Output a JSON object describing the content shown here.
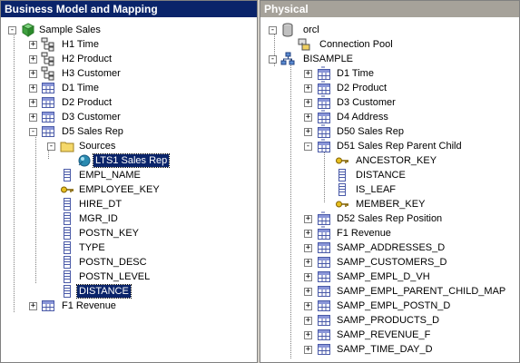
{
  "left_panel": {
    "title": "Business Model and Mapping",
    "nodes": [
      {
        "label": "Sample Sales",
        "icon": "business-model-icon",
        "expander": "-"
      },
      {
        "label": "H1 Time",
        "icon": "hierarchy-icon",
        "expander": "+"
      },
      {
        "label": "H2 Product",
        "icon": "hierarchy-icon",
        "expander": "+"
      },
      {
        "label": "H3 Customer",
        "icon": "hierarchy-icon",
        "expander": "+"
      },
      {
        "label": "D1 Time",
        "icon": "logical-table-icon",
        "expander": "+"
      },
      {
        "label": "D2 Product",
        "icon": "logical-table-icon",
        "expander": "+"
      },
      {
        "label": "D3 Customer",
        "icon": "logical-table-icon",
        "expander": "+"
      },
      {
        "label": "D5 Sales Rep",
        "icon": "logical-table-icon",
        "expander": "-"
      },
      {
        "label": "Sources",
        "icon": "folder-icon",
        "expander": "-"
      },
      {
        "label": "LTS1 Sales Rep",
        "icon": "table-source-icon",
        "expander": ""
      },
      {
        "label": "EMPL_NAME",
        "icon": "column-icon",
        "expander": ""
      },
      {
        "label": "EMPLOYEE_KEY",
        "icon": "key-icon",
        "expander": ""
      },
      {
        "label": "HIRE_DT",
        "icon": "column-icon",
        "expander": ""
      },
      {
        "label": "MGR_ID",
        "icon": "column-icon",
        "expander": ""
      },
      {
        "label": "POSTN_KEY",
        "icon": "column-icon",
        "expander": ""
      },
      {
        "label": "TYPE",
        "icon": "column-icon",
        "expander": ""
      },
      {
        "label": "POSTN_DESC",
        "icon": "column-icon",
        "expander": ""
      },
      {
        "label": "POSTN_LEVEL",
        "icon": "column-icon",
        "expander": ""
      },
      {
        "label": "DISTANCE",
        "icon": "column-icon",
        "expander": ""
      },
      {
        "label": "F1 Revenue",
        "icon": "logical-table-icon",
        "expander": "+"
      }
    ]
  },
  "right_panel": {
    "title": "Physical",
    "nodes": [
      {
        "label": "orcl",
        "icon": "database-icon",
        "expander": "-"
      },
      {
        "label": "Connection Pool",
        "icon": "connection-pool-icon",
        "expander": ""
      },
      {
        "label": "BISAMPLE",
        "icon": "schema-icon",
        "expander": "-"
      },
      {
        "label": "D1 Time",
        "icon": "alias-table-icon",
        "expander": "+"
      },
      {
        "label": "D2 Product",
        "icon": "alias-table-icon",
        "expander": "+"
      },
      {
        "label": "D3 Customer",
        "icon": "alias-table-icon",
        "expander": "+"
      },
      {
        "label": "D4 Address",
        "icon": "alias-table-icon",
        "expander": "+"
      },
      {
        "label": "D50 Sales Rep",
        "icon": "alias-table-icon",
        "expander": "+"
      },
      {
        "label": "D51 Sales Rep Parent Child",
        "icon": "alias-table-icon",
        "expander": "-"
      },
      {
        "label": "ANCESTOR_KEY",
        "icon": "key-icon",
        "expander": ""
      },
      {
        "label": "DISTANCE",
        "icon": "column-icon",
        "expander": ""
      },
      {
        "label": "IS_LEAF",
        "icon": "column-icon",
        "expander": ""
      },
      {
        "label": "MEMBER_KEY",
        "icon": "key-icon",
        "expander": ""
      },
      {
        "label": "D52 Sales Rep Position",
        "icon": "alias-table-icon",
        "expander": "+"
      },
      {
        "label": "F1 Revenue",
        "icon": "alias-table-icon",
        "expander": "+"
      },
      {
        "label": "SAMP_ADDRESSES_D",
        "icon": "physical-table-icon",
        "expander": "+"
      },
      {
        "label": "SAMP_CUSTOMERS_D",
        "icon": "physical-table-icon",
        "expander": "+"
      },
      {
        "label": "SAMP_EMPL_D_VH",
        "icon": "physical-table-icon",
        "expander": "+"
      },
      {
        "label": "SAMP_EMPL_PARENT_CHILD_MAP",
        "icon": "physical-table-icon",
        "expander": "+"
      },
      {
        "label": "SAMP_EMPL_POSTN_D",
        "icon": "physical-table-icon",
        "expander": "+"
      },
      {
        "label": "SAMP_PRODUCTS_D",
        "icon": "physical-table-icon",
        "expander": "+"
      },
      {
        "label": "SAMP_REVENUE_F",
        "icon": "physical-table-icon",
        "expander": "+"
      },
      {
        "label": "SAMP_TIME_DAY_D",
        "icon": "physical-table-icon",
        "expander": "+"
      }
    ]
  },
  "colors": {
    "active_title": "#0a246a",
    "inactive_title": "#a6a29a",
    "selection": "#0a246a",
    "window_bg": "#d4d0c8"
  }
}
